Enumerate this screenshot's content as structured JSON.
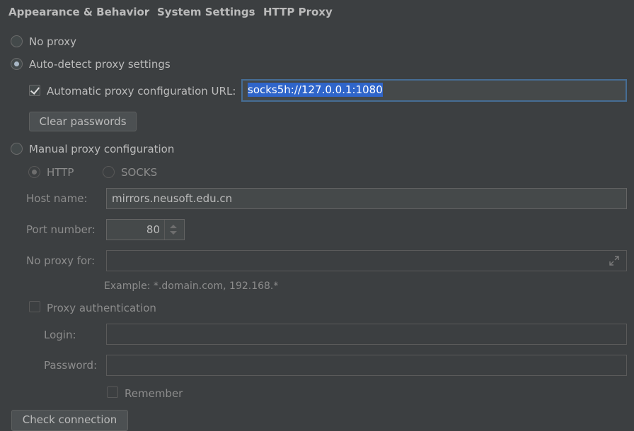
{
  "breadcrumb": {
    "items": [
      "Appearance & Behavior",
      "System Settings",
      "HTTP Proxy"
    ],
    "separator": "›"
  },
  "options": {
    "no_proxy": "No proxy",
    "auto_detect": "Auto-detect proxy settings",
    "auto_url_label": "Automatic proxy configuration URL:",
    "auto_url_value": "socks5h://127.0.0.1:1080",
    "clear_passwords": "Clear passwords",
    "manual": "Manual proxy configuration"
  },
  "manual": {
    "http": "HTTP",
    "socks": "SOCKS",
    "host_label": "Host name:",
    "host_value": "mirrors.neusoft.edu.cn",
    "port_label": "Port number:",
    "port_value": "80",
    "no_proxy_label": "No proxy for:",
    "no_proxy_value": "",
    "example": "Example: *.domain.com, 192.168.*",
    "auth_label": "Proxy authentication",
    "login_label": "Login:",
    "login_value": "",
    "password_label": "Password:",
    "password_value": "",
    "remember": "Remember"
  },
  "check_connection": "Check connection",
  "colors": {
    "background": "#3c3f41",
    "text": "#bbbbbb",
    "selection": "#2f65ca",
    "focus_border": "#466d94"
  }
}
